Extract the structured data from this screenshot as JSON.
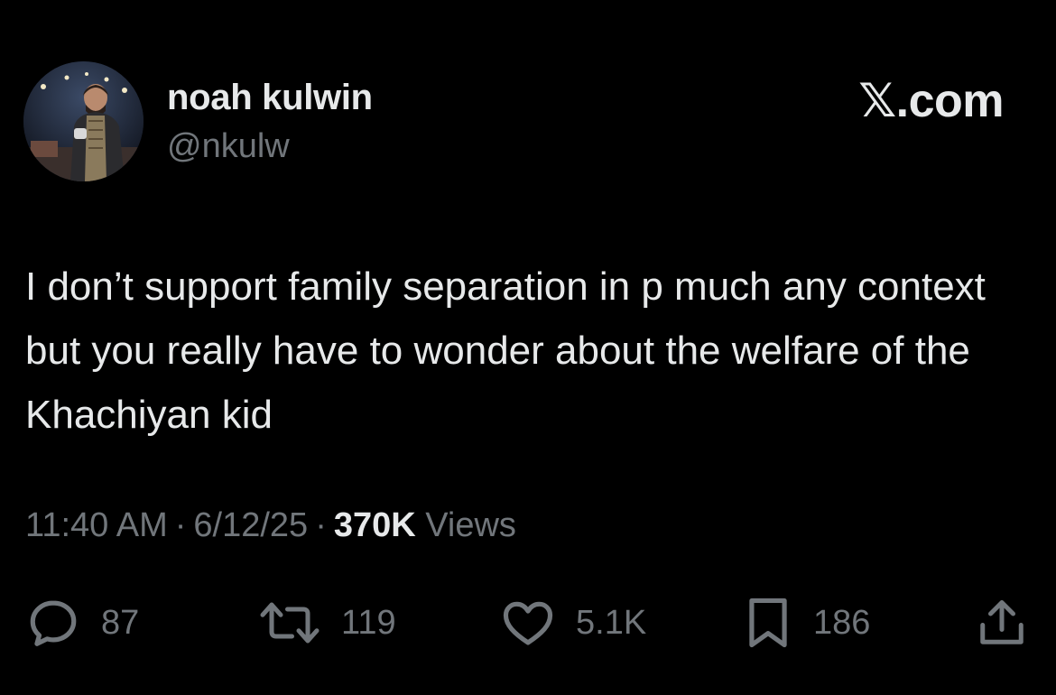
{
  "author": {
    "name": "noah kulwin",
    "handle": "@nkulw",
    "avatar_icon": "profile-photo"
  },
  "brand": "𝕏.com",
  "tweet": {
    "text": "I don’t support family separation in p much any context but you really have to wonder about the welfare of the Khachiyan kid"
  },
  "meta": {
    "time": "11:40 AM",
    "separator": "·",
    "date": "6/12/25",
    "views_count": "370K",
    "views_label": "Views"
  },
  "actions": {
    "reply": {
      "icon": "reply-icon",
      "count": "87"
    },
    "retweet": {
      "icon": "retweet-icon",
      "count": "119"
    },
    "like": {
      "icon": "heart-icon",
      "count": "5.1K"
    },
    "bookmark": {
      "icon": "bookmark-icon",
      "count": "186"
    },
    "share": {
      "icon": "share-icon"
    }
  },
  "colors": {
    "background": "#000000",
    "primary_text": "#e7e9ea",
    "secondary_text": "#71767b"
  }
}
